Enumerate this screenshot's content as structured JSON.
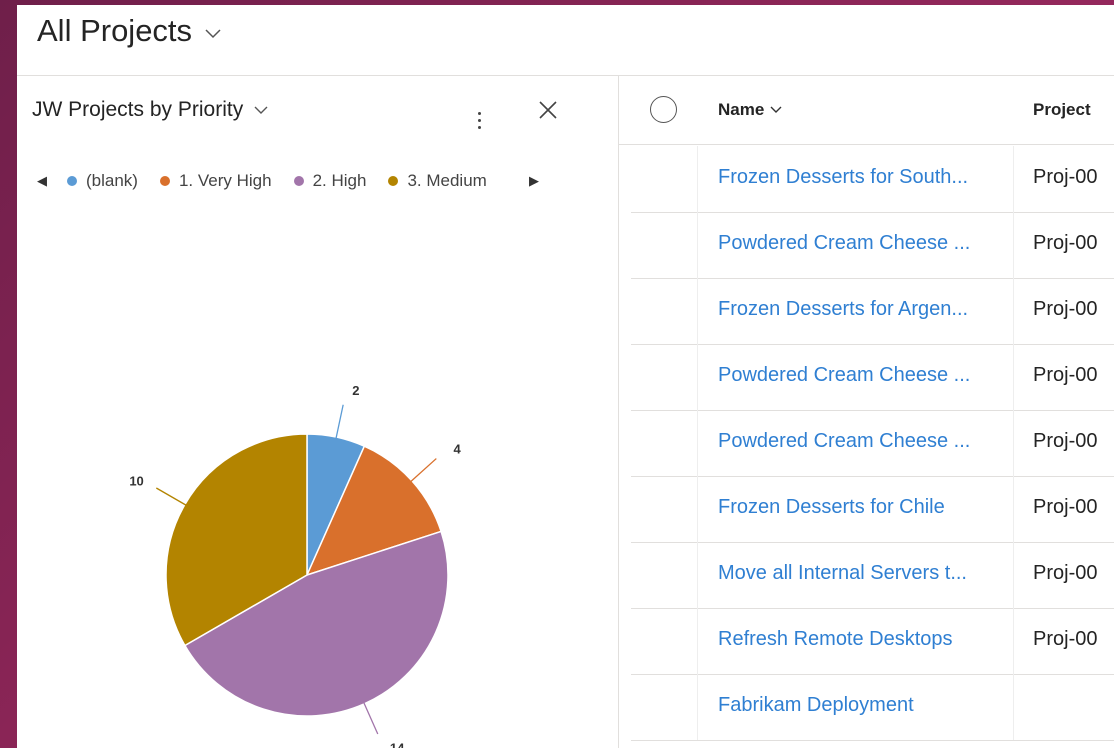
{
  "view": {
    "title": "All Projects"
  },
  "chart": {
    "title": "JW Projects by Priority"
  },
  "legend": [
    {
      "label": "(blank)",
      "color": "#5b9bd5"
    },
    {
      "label": "1. Very High",
      "color": "#d9702c"
    },
    {
      "label": "2. High",
      "color": "#a275aa"
    },
    {
      "label": "3. Medium",
      "color": "#b38400"
    }
  ],
  "chart_data": {
    "type": "pie",
    "categories": [
      "(blank)",
      "1. Very High",
      "2. High",
      "3. Medium"
    ],
    "values": [
      2,
      4,
      14,
      10
    ],
    "colors": [
      "#5b9bd5",
      "#d9702c",
      "#a275aa",
      "#b38400"
    ],
    "title": "JW Projects by Priority",
    "legend_position": "top"
  },
  "grid": {
    "columns": {
      "name": "Name",
      "project": "Project"
    },
    "rows": [
      {
        "name": "Frozen Desserts for South...",
        "project": "Proj-00"
      },
      {
        "name": "Powdered Cream Cheese ...",
        "project": "Proj-00"
      },
      {
        "name": "Frozen Desserts for Argen...",
        "project": "Proj-00"
      },
      {
        "name": "Powdered Cream Cheese ...",
        "project": "Proj-00"
      },
      {
        "name": "Powdered Cream Cheese ...",
        "project": "Proj-00"
      },
      {
        "name": "Frozen Desserts for Chile",
        "project": "Proj-00"
      },
      {
        "name": "Move all Internal Servers t...",
        "project": "Proj-00"
      },
      {
        "name": "Refresh Remote Desktops",
        "project": "Proj-00"
      },
      {
        "name": "Fabrikam Deployment",
        "project": ""
      }
    ]
  }
}
